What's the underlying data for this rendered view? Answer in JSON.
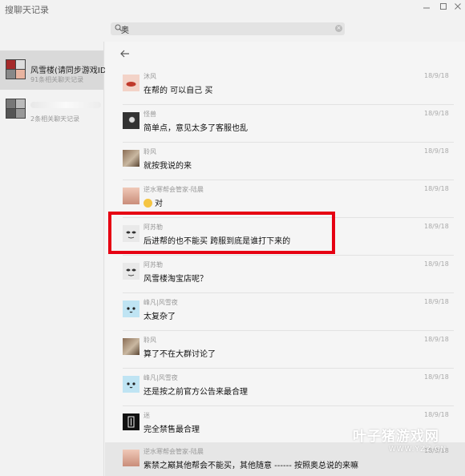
{
  "window": {
    "title": "搜聊天记录",
    "minimize_icon": "minimize-icon",
    "maximize_icon": "maximize-icon",
    "close_icon": "close-icon"
  },
  "search": {
    "value": "奥",
    "search_icon": "search-icon",
    "clear_icon": "clear-icon"
  },
  "sidebar": {
    "conversations": [
      {
        "name": "风雪楼(请同步游戏ID)",
        "count": "91条相关聊天记录",
        "active": true
      },
      {
        "name": "",
        "count": "2条相关聊天记录",
        "active": false
      }
    ]
  },
  "main": {
    "back_icon": "arrow-left-icon",
    "messages": [
      {
        "nick": "沐风",
        "text": "在帮的 可以自己 买",
        "time": "18/9/18",
        "avatar": "lips"
      },
      {
        "nick": "怪兽",
        "text": "简单点，意见太多了客服也乱",
        "time": "18/9/18",
        "avatar": "dark"
      },
      {
        "nick": "聆风",
        "text": "就按我说的来",
        "time": "18/9/18",
        "avatar": "room"
      },
      {
        "nick": "逆水寒帮会管家-陆晨",
        "text": "对",
        "time": "18/9/18",
        "avatar": "girl",
        "emoji": "grin-emoji"
      },
      {
        "nick": "阿苏勒",
        "text": "后进帮的也不能买 跨服到底是谁打下来的",
        "time": "18/9/18",
        "avatar": "face"
      },
      {
        "nick": "阿苏勒",
        "text": "风雪楼淘宝店呢？",
        "time": "18/9/18",
        "avatar": "face"
      },
      {
        "nick": "峰凡|风雪夜",
        "text": "太复杂了",
        "time": "18/9/18",
        "avatar": "cute"
      },
      {
        "nick": "聆风",
        "text": "算了不在大群讨论了",
        "time": "18/9/18",
        "avatar": "room"
      },
      {
        "nick": "峰凡|风雪夜",
        "text": "还是按之前官方公告来最合理",
        "time": "18/9/18",
        "avatar": "cute"
      },
      {
        "nick": "迷",
        "text": "完全禁售最合理",
        "time": "18/9/18",
        "avatar": "bw"
      },
      {
        "nick": "逆水寒帮会管家-陆晨",
        "text": "紫禁之巅其他帮会不能买，其他随意 ------ 按照奥总说的来嘛",
        "time": "18/9/18",
        "avatar": "girl"
      }
    ]
  },
  "watermark": {
    "brand": "叶子猪游戏网",
    "url": "WWW.YZZ.CN"
  },
  "colors": {
    "highlight": "#e60012",
    "active_conversation": "#d9d9d9"
  }
}
